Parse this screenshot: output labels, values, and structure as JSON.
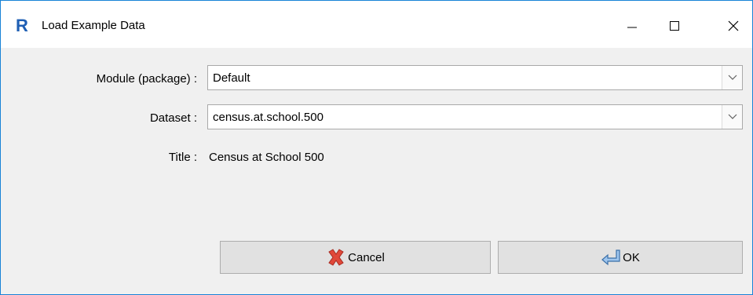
{
  "window": {
    "title": "Load Example Data",
    "icon": "r-logo-icon"
  },
  "form": {
    "module_label": "Module (package) :",
    "module_value": "Default",
    "dataset_label": "Dataset :",
    "dataset_value": "census.at.school.500",
    "title_label": "Title :",
    "title_value": "Census at School 500"
  },
  "buttons": {
    "cancel_label": "Cancel",
    "ok_label": "OK"
  },
  "colors": {
    "window_border": "#1883d7",
    "client_bg": "#f0f0f0",
    "button_bg": "#e1e1e1"
  }
}
